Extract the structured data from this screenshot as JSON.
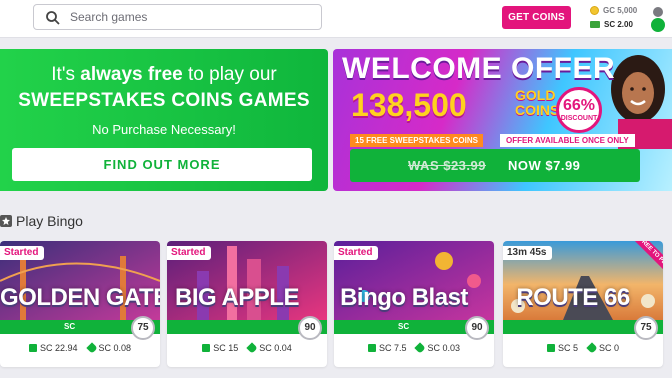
{
  "header": {
    "search_placeholder": "Search games",
    "get_coins_label": "GET COINS",
    "gc_balance": "GC 5,000",
    "sc_balance": "SC 2.00"
  },
  "promo_left": {
    "line1_pre": "It's ",
    "line1_bold": "always free",
    "line1_post": " to play our",
    "line2": "SWEEPSTAKES COINS GAMES",
    "line3": "No Purchase Necessary!",
    "cta_label": "FIND OUT MORE"
  },
  "promo_right": {
    "title": "WELCOME OFFER",
    "amount": "138,500",
    "gold_label_1": "GOLD",
    "gold_label_2": "COINS",
    "discount_pct": "66%",
    "discount_label": "DISCOUNT",
    "tag_sc": "15 FREE SWEEPSTAKES COINS",
    "tag_once": "OFFER AVAILABLE ONCE ONLY",
    "was_price": "WAS $23.99",
    "now_price": "NOW $7.99"
  },
  "section": {
    "title": "Play Bingo"
  },
  "games": [
    {
      "status": "Started",
      "title": "GOLDEN GATE",
      "currency": "SC",
      "ball": "75",
      "prize_total": "SC 22.94",
      "prize_line": "SC 0.08",
      "colors": [
        "#3a2f7a",
        "#c43a9a"
      ]
    },
    {
      "status": "Started",
      "title": "BIG APPLE",
      "currency": "",
      "ball": "90",
      "prize_total": "SC 15",
      "prize_line": "SC 0.04",
      "colors": [
        "#5a1f7a",
        "#e8367f"
      ]
    },
    {
      "status": "Started",
      "title": "Bingo Blast",
      "currency": "SC",
      "ball": "90",
      "prize_total": "SC 7.5",
      "prize_line": "SC 0.03",
      "colors": [
        "#5a1f9a",
        "#c6359e"
      ]
    },
    {
      "status": "13m 45s",
      "title": "ROUTE 66",
      "currency": "",
      "ball": "75",
      "prize_total": "SC 5",
      "prize_line": "SC 0",
      "colors": [
        "#f29a3a",
        "#3a9ad9"
      ],
      "ribbon": "FREE TO PLAY"
    }
  ]
}
